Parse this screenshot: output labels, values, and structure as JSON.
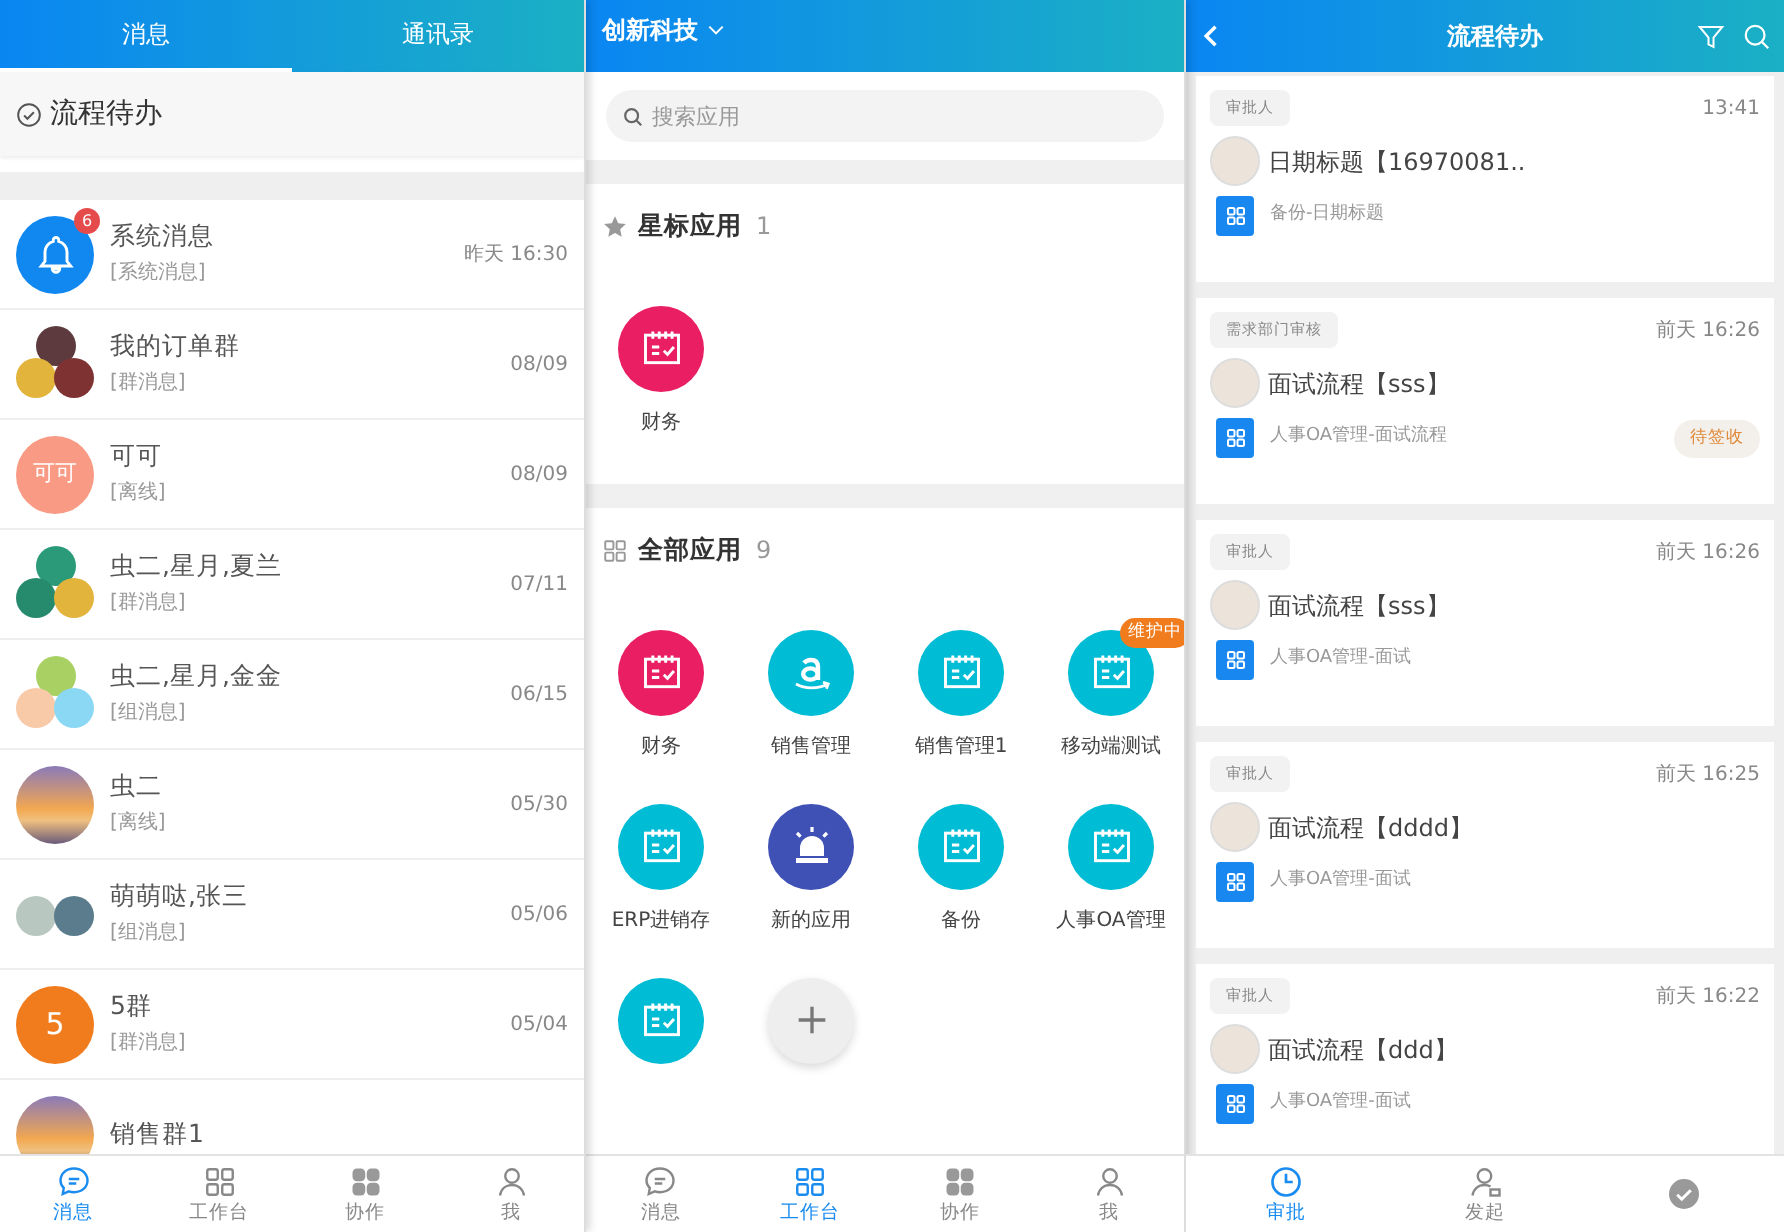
{
  "messages_screen": {
    "tabs": [
      {
        "label": "消息",
        "selected": true
      },
      {
        "label": "通讯录",
        "selected": false
      }
    ],
    "todo_entry": {
      "label": "流程待办"
    },
    "conversations": [
      {
        "name": "系统消息",
        "preview": "[系统消息]",
        "time": "昨天 16:30",
        "badge": "6",
        "avatar": {
          "kind": "bell",
          "color": "#1088f0"
        }
      },
      {
        "name": "我的订单群",
        "preview": "[群消息]",
        "time": "08/09",
        "avatar": {
          "kind": "group",
          "members": [
            {
              "color": "#5c3a3e"
            },
            {
              "color": "#e2b43c"
            },
            {
              "color": "#7e3232"
            }
          ]
        }
      },
      {
        "name": "可可",
        "preview": "[离线]",
        "time": "08/09",
        "avatar": {
          "kind": "initials",
          "text": "可可",
          "color": "#f99a84"
        }
      },
      {
        "name": "虫二,星月,夏兰",
        "preview": "[群消息]",
        "time": "07/11",
        "avatar": {
          "kind": "group",
          "members": [
            {
              "color": "#2a9a78"
            },
            {
              "color": "#268a6c"
            },
            {
              "color": "#e2b43c"
            }
          ]
        }
      },
      {
        "name": "虫二,星月,金金",
        "preview": "[组消息]",
        "time": "06/15",
        "avatar": {
          "kind": "group",
          "members": [
            {
              "color": "#a8d062"
            },
            {
              "color": "#f8caa8"
            },
            {
              "color": "#8ad8f4"
            }
          ]
        }
      },
      {
        "name": "虫二",
        "preview": "[离线]",
        "time": "05/30",
        "avatar": {
          "kind": "photo"
        }
      },
      {
        "name": "萌萌哒,张三",
        "preview": "[组消息]",
        "time": "05/06",
        "avatar": {
          "kind": "pair",
          "members": [
            {
              "color": "#b8c8c0"
            },
            {
              "color": "#5a7c8c"
            }
          ]
        }
      },
      {
        "name": "5群",
        "preview": "[群消息]",
        "time": "05/04",
        "avatar": {
          "kind": "initials",
          "text": "5",
          "color": "#f07c1e"
        }
      },
      {
        "name": "销售群1",
        "avatar": {
          "kind": "photo"
        }
      }
    ],
    "bottom_nav": [
      {
        "label": "消息",
        "kind": "chat",
        "selected": true
      },
      {
        "label": "工作台",
        "kind": "grid",
        "selected": false
      },
      {
        "label": "协作",
        "kind": "blocks",
        "selected": false
      },
      {
        "label": "我",
        "kind": "person",
        "selected": false
      }
    ]
  },
  "workbench_screen": {
    "company": "创新科技",
    "search": {
      "placeholder": "搜索应用"
    },
    "starred": {
      "title": "星标应用",
      "count": "1",
      "apps": [
        {
          "label": "财务",
          "kind": "calendar",
          "color": "#e91e63"
        }
      ]
    },
    "all_apps": {
      "title": "全部应用",
      "count": "9",
      "apps": [
        {
          "label": "财务",
          "kind": "calendar",
          "color": "#e91e63"
        },
        {
          "label": "销售管理",
          "kind": "smile",
          "color": "#00bcd4"
        },
        {
          "label": "销售管理1",
          "kind": "calendar",
          "color": "#00bcd4"
        },
        {
          "label": "移动端测试",
          "kind": "calendar",
          "color": "#00bcd4",
          "badge": "维护中"
        },
        {
          "label": "ERP进销存",
          "kind": "calendar",
          "color": "#00bcd4"
        },
        {
          "label": "新的应用",
          "kind": "alarm",
          "color": "#3f51b5"
        },
        {
          "label": "备份",
          "kind": "calendar",
          "color": "#00bcd4"
        },
        {
          "label": "人事OA管理",
          "kind": "calendar",
          "color": "#00bcd4"
        },
        {
          "kind": "calendar",
          "color": "#00bcd4"
        },
        {
          "kind": "add",
          "color": "#eeeeee"
        }
      ]
    },
    "bottom_nav": [
      {
        "label": "消息",
        "kind": "chat",
        "selected": false
      },
      {
        "label": "工作台",
        "kind": "grid",
        "selected": true
      },
      {
        "label": "协作",
        "kind": "blocks",
        "selected": false
      },
      {
        "label": "我",
        "kind": "person",
        "selected": false
      }
    ]
  },
  "todo_screen": {
    "title": "流程待办",
    "cards": [
      {
        "tag": "审批人",
        "time": "13:41",
        "title": "日期标题【16970081..",
        "source": "备份-日期标题"
      },
      {
        "tag": "需求部门审核",
        "time": "前天 16:26",
        "title": "面试流程【sss】",
        "source": "人事OA管理-面试流程",
        "status": "待签收"
      },
      {
        "tag": "审批人",
        "time": "前天 16:26",
        "title": "面试流程【sss】",
        "source": "人事OA管理-面试"
      },
      {
        "tag": "审批人",
        "time": "前天 16:25",
        "title": "面试流程【dddd】",
        "source": "人事OA管理-面试"
      },
      {
        "tag": "审批人",
        "time": "前天 16:22",
        "title": "面试流程【ddd】",
        "source": "人事OA管理-面试"
      }
    ],
    "bottom_nav": [
      {
        "label": "审批",
        "kind": "clock",
        "selected": true
      },
      {
        "label": "发起",
        "kind": "person-search",
        "selected": false
      },
      {
        "kind": "check-circle",
        "selected": false
      }
    ]
  }
}
